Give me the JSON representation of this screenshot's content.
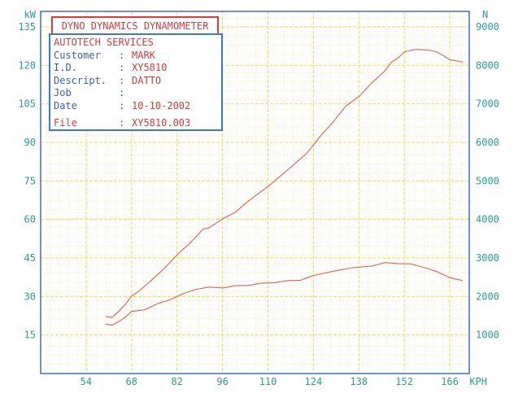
{
  "header": {
    "title": "DYNO DYNAMICS DYNAMOMETER"
  },
  "info": {
    "company": "AUTOTECH SERVICES",
    "rows": [
      {
        "label": "Customer",
        "sep": ":",
        "value": "MARK"
      },
      {
        "label": "I.D.",
        "sep": ":",
        "value": "XY5810"
      },
      {
        "label": "Descript.",
        "sep": ":",
        "value": "DATTO"
      },
      {
        "label": "Job",
        "sep": ":",
        "value": ""
      },
      {
        "label": "Date",
        "sep": ":",
        "value": "10-10-2002"
      }
    ],
    "file": {
      "label": "File",
      "sep": ":",
      "value": "XY5810.003"
    }
  },
  "colors": {
    "grid": "#e4e060",
    "axis": "#3a6fc8",
    "tick_text": "#2a9e95",
    "curve": "#e36050",
    "title_border": "#e23a3a",
    "info_border": "#3c76d6"
  },
  "chart_data": {
    "type": "line",
    "xlabel": "KPH",
    "ylabel_left": "kW",
    "ylabel_right": "N",
    "x_ticks": [
      54,
      68,
      82,
      96,
      110,
      124,
      138,
      152,
      166
    ],
    "x_tick_labels": [
      "54",
      "68",
      "82",
      "96",
      "110",
      "124",
      "138",
      "152",
      "166"
    ],
    "y_left_ticks": [
      15,
      30,
      45,
      60,
      75,
      90,
      105,
      120,
      135
    ],
    "y_left_tick_labels": [
      "15",
      "30",
      "45",
      "60",
      "75",
      "90",
      "105",
      "120",
      "135"
    ],
    "y_right_ticks": [
      1000,
      2000,
      3000,
      4000,
      5000,
      6000,
      7000,
      8000,
      9000
    ],
    "y_right_tick_labels": [
      "1000",
      "2000",
      "3000",
      "4000",
      "5000",
      "6000",
      "7000",
      "8000",
      "9000"
    ],
    "xlim": [
      40,
      172
    ],
    "ylim_left": [
      0,
      141
    ],
    "ylim_right": [
      0,
      9400
    ],
    "grid": true,
    "series": [
      {
        "axis": "left",
        "x": [
          60,
          62,
          64,
          66,
          68,
          70,
          74,
          78,
          82,
          86,
          90,
          92,
          96,
          100,
          104,
          110,
          116,
          122,
          126,
          130,
          134,
          138,
          142,
          146,
          148,
          150,
          152,
          154,
          156,
          160,
          162,
          164,
          166,
          168,
          170
        ],
        "y": [
          22,
          22,
          24,
          27,
          30,
          32,
          36,
          41,
          46,
          51,
          56,
          57,
          60,
          63,
          67,
          73,
          79,
          86,
          92,
          98,
          104,
          108,
          113,
          118,
          121,
          123,
          125,
          126,
          126,
          126,
          125,
          124,
          122,
          122,
          121
        ]
      },
      {
        "axis": "left",
        "x": [
          60,
          62,
          64,
          66,
          68,
          72,
          76,
          80,
          84,
          88,
          92,
          96,
          100,
          104,
          108,
          112,
          116,
          120,
          124,
          130,
          136,
          142,
          146,
          150,
          154,
          158,
          162,
          166,
          170
        ],
        "y": [
          19,
          19,
          20,
          22,
          24,
          25,
          27,
          29,
          31,
          33,
          33.5,
          33.5,
          34,
          34.5,
          35,
          35.5,
          36,
          36.5,
          38,
          40,
          41,
          42,
          43,
          43,
          42.5,
          41.5,
          39.5,
          37.5,
          36
        ]
      }
    ]
  }
}
